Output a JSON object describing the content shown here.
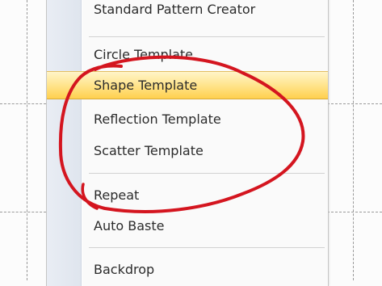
{
  "menu": {
    "items": [
      {
        "label": "Standard Pattern Creator"
      },
      {
        "label": "Circle Template"
      },
      {
        "label": "Shape Template"
      },
      {
        "label": "Reflection Template"
      },
      {
        "label": "Scatter Template"
      },
      {
        "label": "Repeat"
      },
      {
        "label": "Auto Baste"
      },
      {
        "label": "Backdrop"
      }
    ],
    "highlighted_item": "Shape Template"
  },
  "colors": {
    "highlight": "#ffd04e",
    "annotation": "#d4151f",
    "gutter": "#e3e8f0"
  }
}
